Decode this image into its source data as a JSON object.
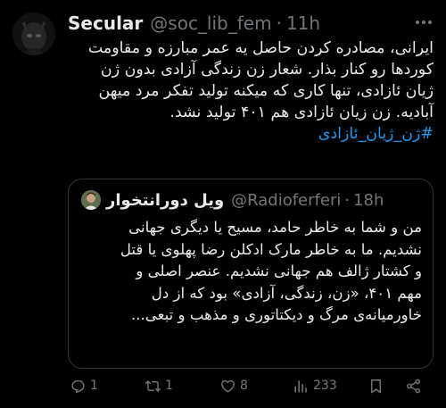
{
  "author": {
    "display_name": "Secular",
    "handle": "@soc_lib_fem",
    "separator": "·",
    "time": "11h"
  },
  "body": {
    "lines": [
      "ایرانی، مصادره کردن حاصل یه عمر مبارزه و مقاومت",
      "کوردها رو کنار بذار. شعار زن زندگی آزادی بدون ژن",
      "ژیان ئازادی، تنها کاری که میکنه تولید تفکر مرد میهن",
      "آبادیه. زن زیان ئازادی هم ۴۰۱ تولید نشد."
    ],
    "hashtag": "#ژن_ژیان_ئازادی"
  },
  "quote": {
    "display_name": "ویل دورانتخوار",
    "handle": "@Radioferferi",
    "separator": "·",
    "time": "18h",
    "lines": [
      "من و شما به خاطر حامد، مسیح یا دیگری جهانی",
      "نشدیم. ما به خاطر مارک ادکلن رضا پهلوی یا قتل",
      "و کشتار ژالف هم جهانی نشدیم. عنصر اصلی و",
      "مهم ۴۰۱، «زن، زندگی، آزادی» بود که از دل",
      "خاورمیانه‌ی مرگ و دیکتاتوری و مذهب و تبعی..."
    ]
  },
  "actions": {
    "reply_count": "1",
    "repost_count": "1",
    "like_count": "8",
    "view_count": "233"
  },
  "icons": {
    "reply": "reply-icon",
    "repost": "repost-icon",
    "like": "heart-icon",
    "views": "views-icon",
    "bookmark": "bookmark-icon",
    "share": "share-icon",
    "more": "more-icon"
  },
  "colors": {
    "background": "#000000",
    "text": "#e7e9ea",
    "muted": "#71767b",
    "link": "#1d9bf0",
    "border": "#2f3336"
  }
}
